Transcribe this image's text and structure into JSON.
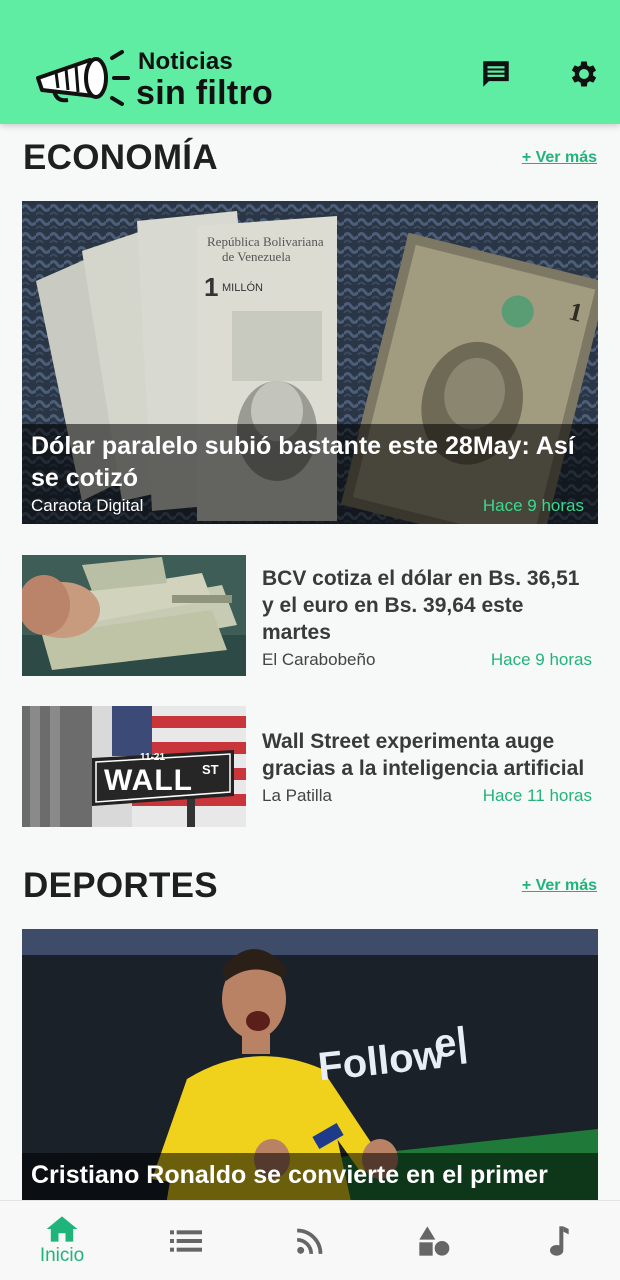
{
  "app": {
    "brand_line1": "Noticias",
    "brand_line2": "sin filtro",
    "colors": {
      "header": "#5eeda2",
      "accent": "#1fb57a"
    },
    "header_icons": [
      "message-icon",
      "gear-icon"
    ]
  },
  "sections": [
    {
      "title": "ECONOMÍA",
      "more": "+ Ver más",
      "featured": {
        "title": "Dólar paralelo subió bastante este 28May: Así se cotizó",
        "source": "Caraota Digital",
        "time": "Hace 9 horas"
      },
      "items": [
        {
          "title": "BCV cotiza el dólar en Bs. 36,51 y el euro en Bs. 39,64 este martes",
          "source": "El Carabobeño",
          "time": "Hace 9 horas"
        },
        {
          "title": "Wall Street experimenta auge gracias a la inteligencia artificial",
          "source": "La Patilla",
          "time": "Hace 11 horas",
          "thumb_sign": "WALL",
          "thumb_sign_sup": "ST",
          "thumb_sign_small": "11-21"
        }
      ]
    },
    {
      "title": "DEPORTES",
      "more": "+ Ver más",
      "featured": {
        "title": "Cristiano Ronaldo se convierte en el primer",
        "image_text": "Follow",
        "image_text2": "e|"
      }
    }
  ],
  "bottom_nav": [
    {
      "label": "Inicio",
      "icon": "home-icon",
      "active": true
    },
    {
      "label": "",
      "icon": "list-icon",
      "active": false
    },
    {
      "label": "",
      "icon": "rss-icon",
      "active": false
    },
    {
      "label": "",
      "icon": "shapes-icon",
      "active": false
    },
    {
      "label": "",
      "icon": "music-note-icon",
      "active": false
    }
  ]
}
